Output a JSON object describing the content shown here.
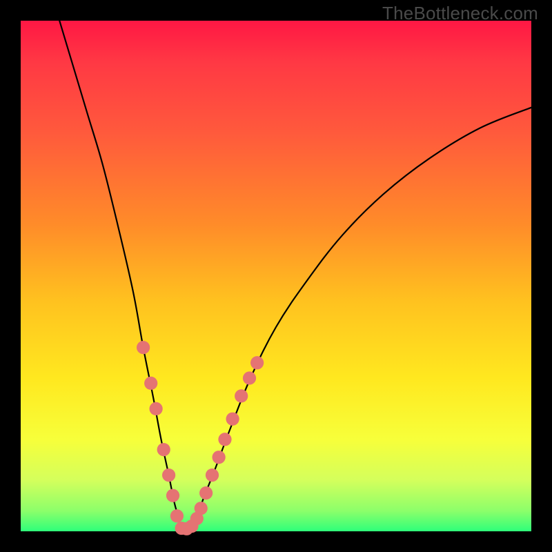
{
  "watermark": "TheBottleneck.com",
  "colors": {
    "curve": "#000000",
    "marker": "#e57373",
    "background_frame": "#000000"
  },
  "chart_data": {
    "type": "line",
    "title": "",
    "xlabel": "",
    "ylabel": "",
    "xlim": [
      0,
      100
    ],
    "ylim": [
      0,
      100
    ],
    "note": "V-shaped curve. x is horizontal position in plot-area percent (0=left,100=right); y is percent from top (0=top,100=bottom). Values estimated from pixels; no axis ticks visible.",
    "series": [
      {
        "name": "curve",
        "x": [
          7,
          10,
          13,
          16,
          19,
          22,
          24,
          26,
          27.5,
          29,
          30,
          30.8,
          31.5,
          33,
          34.5,
          36,
          38,
          41,
          45,
          50,
          56,
          63,
          71,
          80,
          90,
          100
        ],
        "y": [
          -2,
          8,
          18,
          28,
          40,
          53,
          64,
          74,
          82,
          89,
          94,
          97,
          99.5,
          99,
          97,
          93,
          88,
          80,
          70,
          60,
          51,
          42,
          34,
          27,
          21,
          17
        ]
      }
    ],
    "markers": {
      "name": "highlighted-points",
      "color": "#e57373",
      "radius_pct": 1.3,
      "points": [
        {
          "x": 24.0,
          "y": 64
        },
        {
          "x": 25.5,
          "y": 71
        },
        {
          "x": 26.5,
          "y": 76
        },
        {
          "x": 28.0,
          "y": 84
        },
        {
          "x": 29.0,
          "y": 89
        },
        {
          "x": 29.8,
          "y": 93
        },
        {
          "x": 30.6,
          "y": 97
        },
        {
          "x": 31.5,
          "y": 99.4
        },
        {
          "x": 32.5,
          "y": 99.5
        },
        {
          "x": 33.5,
          "y": 99.0
        },
        {
          "x": 34.5,
          "y": 97.5
        },
        {
          "x": 35.3,
          "y": 95.5
        },
        {
          "x": 36.3,
          "y": 92.5
        },
        {
          "x": 37.5,
          "y": 89.0
        },
        {
          "x": 38.8,
          "y": 85.5
        },
        {
          "x": 40.0,
          "y": 82.0
        },
        {
          "x": 41.5,
          "y": 78.0
        },
        {
          "x": 43.2,
          "y": 73.5
        },
        {
          "x": 44.8,
          "y": 70.0
        },
        {
          "x": 46.3,
          "y": 67.0
        }
      ]
    }
  }
}
